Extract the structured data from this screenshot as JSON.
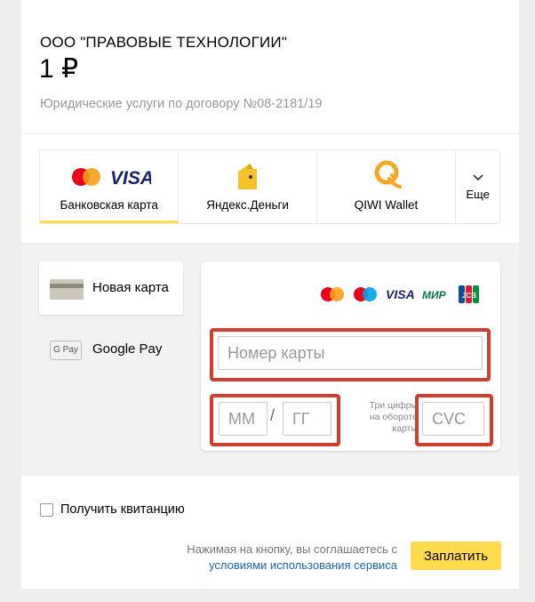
{
  "header": {
    "merchant": "ООО \"ПРАВОВЫЕ ТЕХНОЛОГИИ\"",
    "amount": "1 ₽",
    "description": "Юридические услуги по договору №08-2181/19"
  },
  "tabs": [
    {
      "label": "Банковская карта",
      "icon": "mastercard-visa-icon",
      "active": true
    },
    {
      "label": "Яндекс.Деньги",
      "icon": "yandex-money-icon"
    },
    {
      "label": "QIWI Wallet",
      "icon": "qiwi-icon"
    },
    {
      "label": "Еще",
      "icon": "chevron-down-icon"
    }
  ],
  "methods": [
    {
      "label": "Новая карта",
      "icon": "card-icon",
      "selected": true
    },
    {
      "label": "Google Pay",
      "icon": "google-pay-icon",
      "icon_text": "G Pay"
    }
  ],
  "form": {
    "card_number_placeholder": "Номер карты",
    "month_placeholder": "ММ",
    "year_placeholder": "ГГ",
    "date_separator": "/",
    "cvc_hint": "Три цифры на обороте карты",
    "cvc_placeholder": "CVC",
    "logos": {
      "visa": "VISA",
      "mir": "МИР",
      "jcb": "JCB"
    }
  },
  "receipt_label": "Получить квитанцию",
  "terms": {
    "text": "Нажимая на кнопку, вы соглашаетесь с",
    "link": "условиями использования сервиса"
  },
  "pay_button": "Заплатить",
  "colors": {
    "accent": "#ffdb4d",
    "link": "#1b63b8",
    "highlight_border": "#d13d2f",
    "mastercard_red": "#eb001b",
    "mastercard_orange": "#f79e1b",
    "visa_blue": "#1a1f71"
  }
}
